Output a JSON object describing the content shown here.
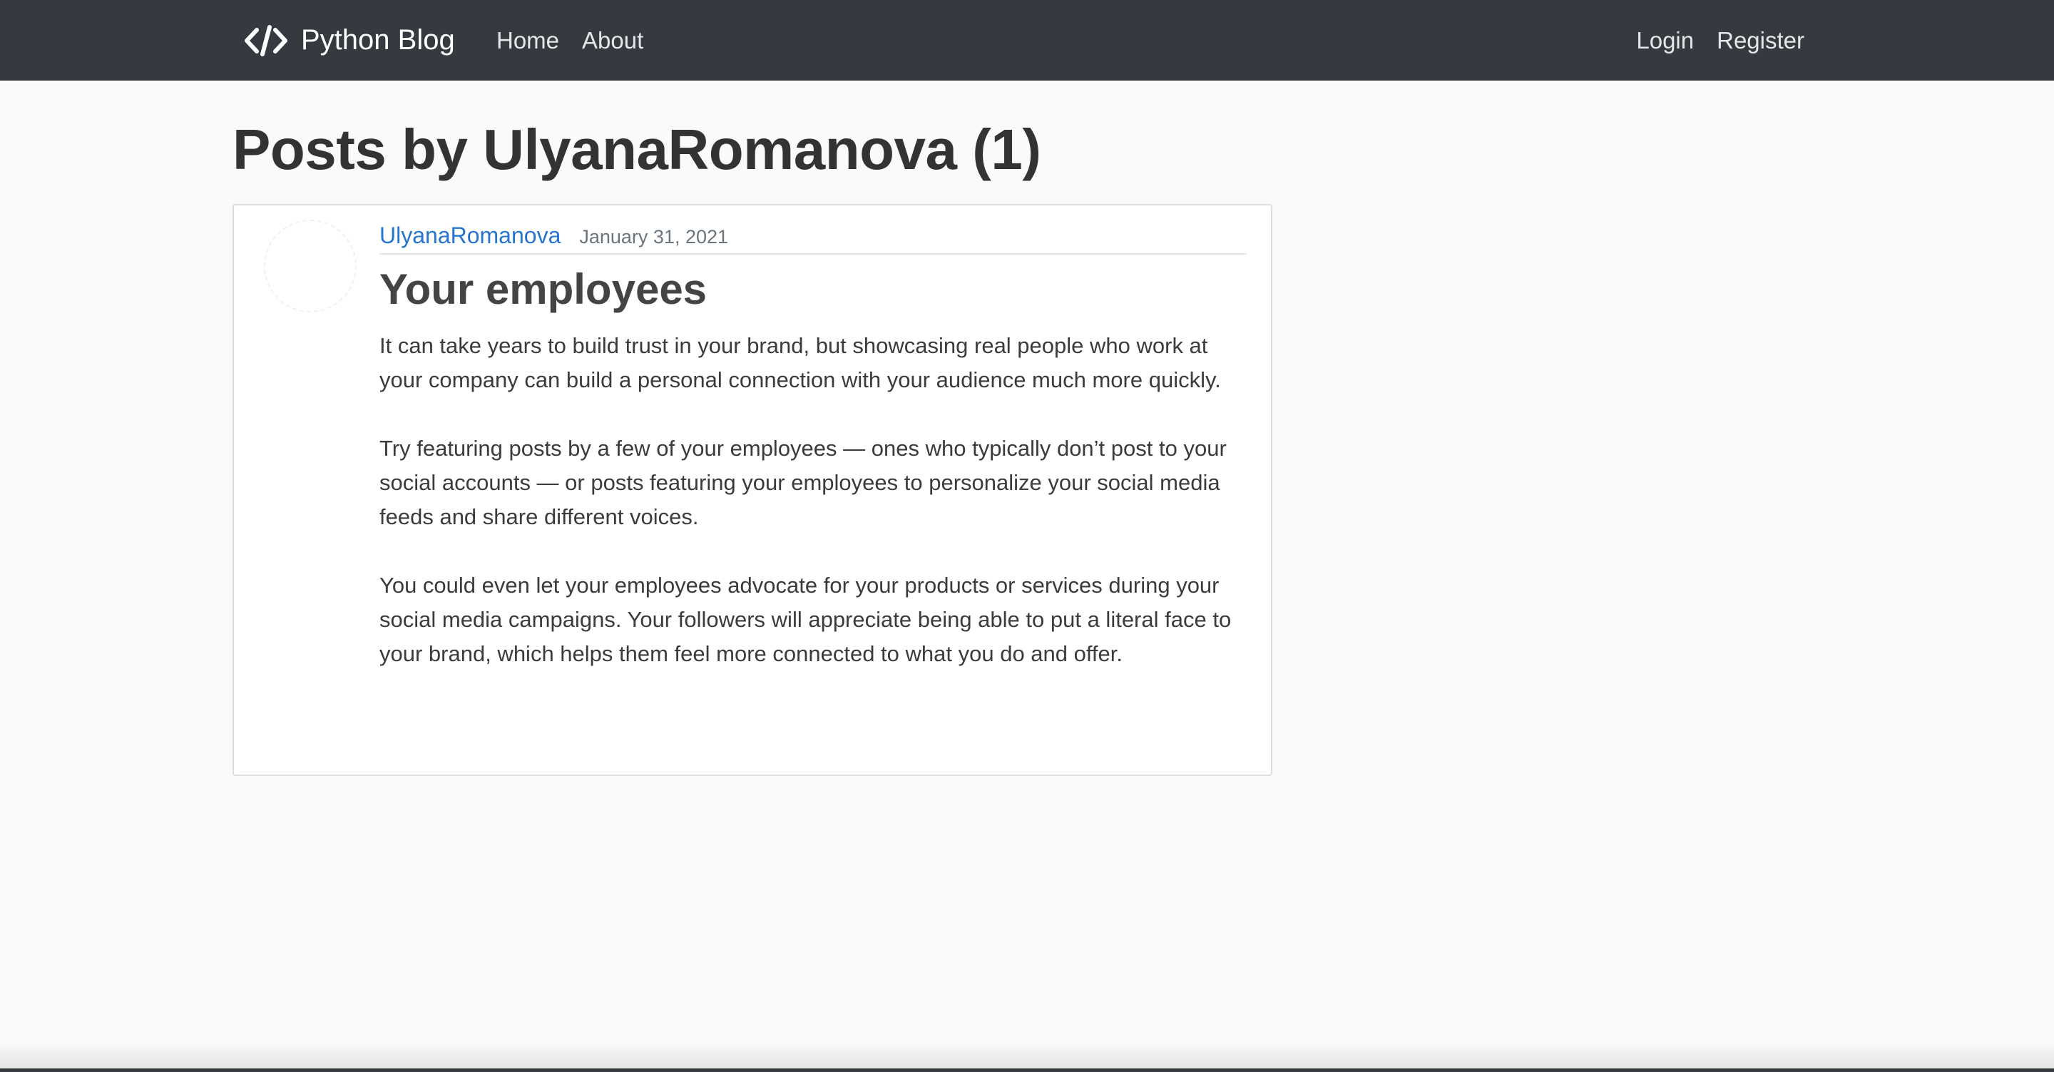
{
  "navbar": {
    "brand_label": "Python Blog",
    "brand_icon": "code-icon",
    "left_links": [
      "Home",
      "About"
    ],
    "right_links": [
      "Login",
      "Register"
    ]
  },
  "page": {
    "title": "Posts by UlyanaRomanova (1)"
  },
  "post": {
    "author": "UlyanaRomanova",
    "date": "January 31, 2021",
    "title": "Your employees",
    "paragraphs": [
      "It can take years to build trust in your brand, but showcasing real people who work at your company can build a personal connection with your audience much more quickly.",
      "Try featuring posts by a few of your employees — ones who typically don’t post to your social accounts — or posts featuring your employees to personalize your social media feeds and share different voices.",
      "You could even let your employees advocate for your products or services during your social media campaigns. Your followers will appreciate being able to put a literal face to your brand, which helps them feel more connected to what you do and offer."
    ]
  },
  "colors": {
    "navbar": "#343a40",
    "link": "#2774d1",
    "background": "#fafafa"
  }
}
